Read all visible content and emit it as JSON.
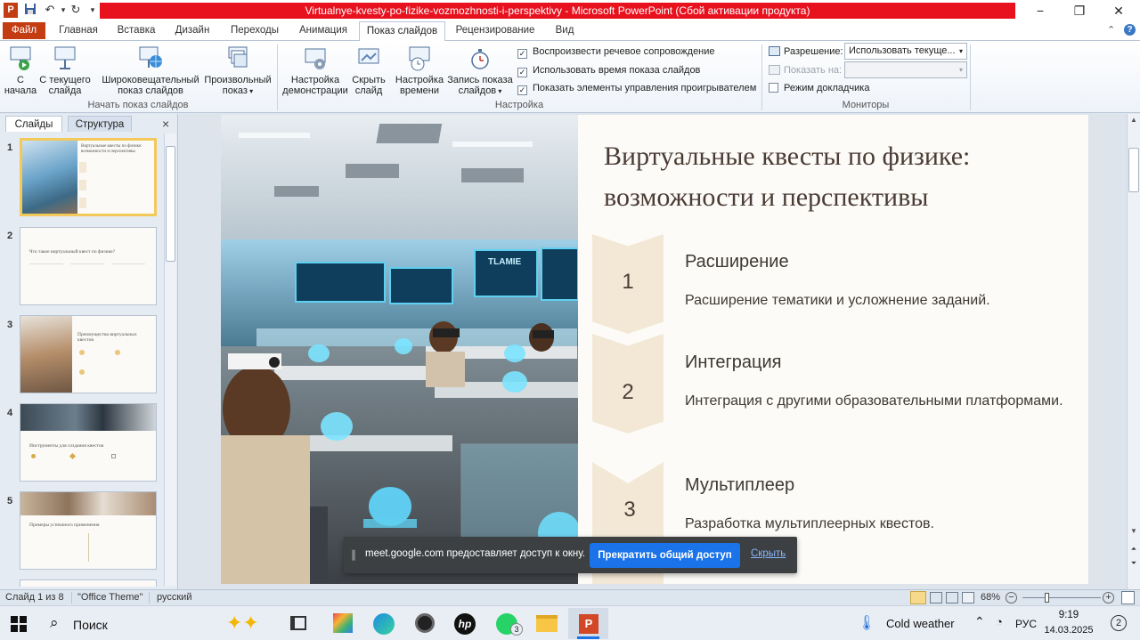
{
  "window": {
    "title": "Virtualnye-kvesty-po-fizike-vozmozhnosti-i-perspektivy  -  Microsoft PowerPoint (Сбой активации продукта)",
    "minimize": "−",
    "restore": "❐",
    "close": "✕"
  },
  "tabs": {
    "file": "Файл",
    "home": "Главная",
    "insert": "Вставка",
    "design": "Дизайн",
    "transitions": "Переходы",
    "animation": "Анимация",
    "slideshow": "Показ слайдов",
    "review": "Рецензирование",
    "view": "Вид"
  },
  "ribbon": {
    "from_start": [
      "С",
      "начала"
    ],
    "from_current": [
      "С текущего",
      "слайда"
    ],
    "broadcast": [
      "Широковещательный",
      "показ слайдов"
    ],
    "custom": [
      "Произвольный",
      "показ"
    ],
    "group_start": "Начать показ слайдов",
    "setup": [
      "Настройка",
      "демонстрации"
    ],
    "hide": [
      "Скрыть",
      "слайд"
    ],
    "rehearse": [
      "Настройка",
      "времени"
    ],
    "record": [
      "Запись показа",
      "слайдов"
    ],
    "chk_narration": "Воспроизвести речевое сопровождение",
    "chk_timings": "Использовать время показа слайдов",
    "chk_controls": "Показать элементы управления проигрывателем",
    "group_setup": "Настройка",
    "resolution_label": "Разрешение:",
    "resolution_value": "Использовать текуще...",
    "show_on_label": "Показать на:",
    "presenter_view": "Режим докладчика",
    "group_monitors": "Мониторы"
  },
  "leftpane": {
    "tab_slides": "Слайды",
    "tab_outline": "Структура",
    "close": "×",
    "thumbs": [
      {
        "num": "1",
        "title": "Виртуальные квесты по физике: возможности и перспективы"
      },
      {
        "num": "2",
        "title": "Что такое виртуальный квест по физике?"
      },
      {
        "num": "3",
        "title": "Преимущества виртуальных квестов"
      },
      {
        "num": "4",
        "title": "Инструменты для создания квестов"
      },
      {
        "num": "5",
        "title": "Примеры успешного применения"
      }
    ]
  },
  "slide": {
    "title_line1": "Виртуальные квесты по физике:",
    "title_line2": "возможности и перспективы",
    "items": [
      {
        "num": "1",
        "heading": "Расширение",
        "text": "Расширение тематики и усложнение заданий."
      },
      {
        "num": "2",
        "heading": "Интеграция",
        "text": "Интеграция с другими образовательными платформами."
      },
      {
        "num": "3",
        "heading": "Мультиплеер",
        "text": "Разработка мультиплеерных квестов."
      }
    ],
    "screen_text": "TLAMIE"
  },
  "sharebar": {
    "message": "meet.google.com предоставляет доступ к окну.",
    "stop": "Прекратить общий доступ",
    "hide": "Скрыть"
  },
  "status": {
    "slide_of": "Слайд 1 из 8",
    "theme": "\"Office Theme\"",
    "language": "русский",
    "zoom": "68%",
    "zoom_fraction": 0.68
  },
  "taskbar": {
    "search": "Поиск",
    "weather": "Cold weather",
    "lang": "РУС",
    "time": "9:19",
    "date": "14.03.2025",
    "notif_count": "2",
    "whatsapp_badge": "3"
  },
  "colors": {
    "title_red": "#e8111e",
    "file_tab": "#c33c12",
    "share_button": "#1a73e8",
    "slide_title": "#4a3c34",
    "chevron": "#f3e8d6"
  }
}
